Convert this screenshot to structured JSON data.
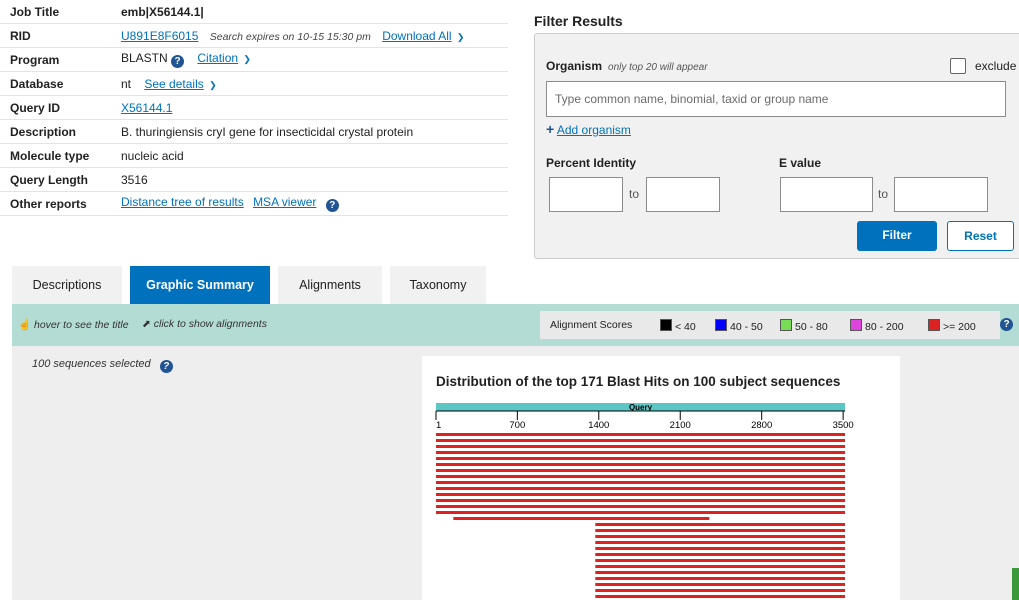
{
  "summary": {
    "job_title": {
      "label": "Job Title",
      "value": "emb|X56144.1|"
    },
    "rid": {
      "label": "RID",
      "value": "U891E8F6015",
      "expires": "Search expires on 10-15 15:30 pm",
      "download": "Download All"
    },
    "program": {
      "label": "Program",
      "value": "BLASTN",
      "citation": "Citation"
    },
    "database": {
      "label": "Database",
      "value": "nt",
      "details": "See details"
    },
    "query_id": {
      "label": "Query ID",
      "value": "X56144.1"
    },
    "description": {
      "label": "Description",
      "value": "B. thuringiensis cryI gene for insecticidal crystal protein"
    },
    "molecule_type": {
      "label": "Molecule type",
      "value": "nucleic acid"
    },
    "query_length": {
      "label": "Query Length",
      "value": "3516"
    },
    "other_reports": {
      "label": "Other reports",
      "distance_tree": "Distance tree of results",
      "msa_viewer": "MSA viewer"
    }
  },
  "filter": {
    "title": "Filter Results",
    "organism_label": "Organism",
    "organism_hint": "only top 20 will appear",
    "exclude_label": "exclude",
    "organism_placeholder": "Type common name, binomial, taxid or group name",
    "add_organism": "Add organism",
    "percent_identity_label": "Percent Identity",
    "evalue_label": "E value",
    "to_label": "to",
    "filter_button": "Filter",
    "reset_button": "Reset"
  },
  "tabs": [
    {
      "label": "Descriptions",
      "active": false
    },
    {
      "label": "Graphic Summary",
      "active": true
    },
    {
      "label": "Alignments",
      "active": false
    },
    {
      "label": "Taxonomy",
      "active": false
    }
  ],
  "legend": {
    "hover_hint": "hover to see the title",
    "click_hint": "click to show alignments",
    "scores_label": "Alignment Scores",
    "items": [
      {
        "label": "< 40",
        "color": "#000000"
      },
      {
        "label": "40 - 50",
        "color": "#0000ff"
      },
      {
        "label": "50 - 80",
        "color": "#77dd55"
      },
      {
        "label": "80 - 200",
        "color": "#dd44dd"
      },
      {
        "label": ">= 200",
        "color": "#dd2222"
      }
    ]
  },
  "graphic": {
    "selected_note": "100 sequences selected",
    "title": "Distribution of the top 171 Blast Hits on 100 subject sequences",
    "query_label": "Query",
    "axis_max": 3516,
    "ticks": [
      "1",
      "700",
      "1400",
      "2100",
      "2800",
      "3500"
    ],
    "query_color": "#5bc6c4",
    "hit_color": "#dd2222",
    "hits": [
      {
        "start": 1,
        "end": 3516
      },
      {
        "start": 1,
        "end": 3516
      },
      {
        "start": 1,
        "end": 3516
      },
      {
        "start": 1,
        "end": 3516
      },
      {
        "start": 1,
        "end": 3516
      },
      {
        "start": 1,
        "end": 3516
      },
      {
        "start": 1,
        "end": 3516
      },
      {
        "start": 1,
        "end": 3516
      },
      {
        "start": 1,
        "end": 3516
      },
      {
        "start": 1,
        "end": 3516
      },
      {
        "start": 1,
        "end": 3516
      },
      {
        "start": 1,
        "end": 3516
      },
      {
        "start": 1,
        "end": 3516
      },
      {
        "start": 1,
        "end": 3516
      },
      {
        "start": 150,
        "end": 2350
      },
      {
        "start": 1370,
        "end": 3516
      },
      {
        "start": 1370,
        "end": 3516
      },
      {
        "start": 1370,
        "end": 3516
      },
      {
        "start": 1370,
        "end": 3516
      },
      {
        "start": 1370,
        "end": 3516
      },
      {
        "start": 1370,
        "end": 3516
      },
      {
        "start": 1370,
        "end": 3516
      },
      {
        "start": 1370,
        "end": 3516
      },
      {
        "start": 1370,
        "end": 3516
      },
      {
        "start": 1370,
        "end": 3516
      },
      {
        "start": 1370,
        "end": 3516
      },
      {
        "start": 1370,
        "end": 3516
      },
      {
        "start": 1370,
        "end": 3516
      }
    ]
  }
}
